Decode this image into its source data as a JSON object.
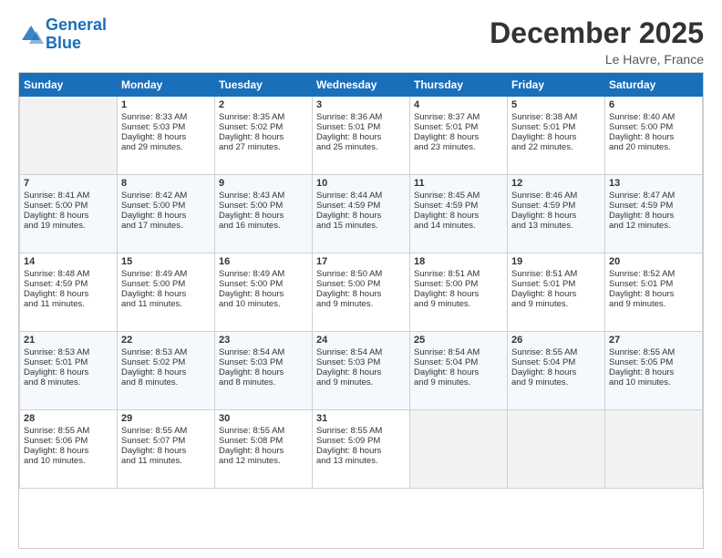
{
  "header": {
    "logo_line1": "General",
    "logo_line2": "Blue",
    "month": "December 2025",
    "location": "Le Havre, France"
  },
  "weekdays": [
    "Sunday",
    "Monday",
    "Tuesday",
    "Wednesday",
    "Thursday",
    "Friday",
    "Saturday"
  ],
  "weeks": [
    [
      {
        "day": "",
        "info": ""
      },
      {
        "day": "1",
        "info": "Sunrise: 8:33 AM\nSunset: 5:03 PM\nDaylight: 8 hours\nand 29 minutes."
      },
      {
        "day": "2",
        "info": "Sunrise: 8:35 AM\nSunset: 5:02 PM\nDaylight: 8 hours\nand 27 minutes."
      },
      {
        "day": "3",
        "info": "Sunrise: 8:36 AM\nSunset: 5:01 PM\nDaylight: 8 hours\nand 25 minutes."
      },
      {
        "day": "4",
        "info": "Sunrise: 8:37 AM\nSunset: 5:01 PM\nDaylight: 8 hours\nand 23 minutes."
      },
      {
        "day": "5",
        "info": "Sunrise: 8:38 AM\nSunset: 5:01 PM\nDaylight: 8 hours\nand 22 minutes."
      },
      {
        "day": "6",
        "info": "Sunrise: 8:40 AM\nSunset: 5:00 PM\nDaylight: 8 hours\nand 20 minutes."
      }
    ],
    [
      {
        "day": "7",
        "info": "Sunrise: 8:41 AM\nSunset: 5:00 PM\nDaylight: 8 hours\nand 19 minutes."
      },
      {
        "day": "8",
        "info": "Sunrise: 8:42 AM\nSunset: 5:00 PM\nDaylight: 8 hours\nand 17 minutes."
      },
      {
        "day": "9",
        "info": "Sunrise: 8:43 AM\nSunset: 5:00 PM\nDaylight: 8 hours\nand 16 minutes."
      },
      {
        "day": "10",
        "info": "Sunrise: 8:44 AM\nSunset: 4:59 PM\nDaylight: 8 hours\nand 15 minutes."
      },
      {
        "day": "11",
        "info": "Sunrise: 8:45 AM\nSunset: 4:59 PM\nDaylight: 8 hours\nand 14 minutes."
      },
      {
        "day": "12",
        "info": "Sunrise: 8:46 AM\nSunset: 4:59 PM\nDaylight: 8 hours\nand 13 minutes."
      },
      {
        "day": "13",
        "info": "Sunrise: 8:47 AM\nSunset: 4:59 PM\nDaylight: 8 hours\nand 12 minutes."
      }
    ],
    [
      {
        "day": "14",
        "info": "Sunrise: 8:48 AM\nSunset: 4:59 PM\nDaylight: 8 hours\nand 11 minutes."
      },
      {
        "day": "15",
        "info": "Sunrise: 8:49 AM\nSunset: 5:00 PM\nDaylight: 8 hours\nand 11 minutes."
      },
      {
        "day": "16",
        "info": "Sunrise: 8:49 AM\nSunset: 5:00 PM\nDaylight: 8 hours\nand 10 minutes."
      },
      {
        "day": "17",
        "info": "Sunrise: 8:50 AM\nSunset: 5:00 PM\nDaylight: 8 hours\nand 9 minutes."
      },
      {
        "day": "18",
        "info": "Sunrise: 8:51 AM\nSunset: 5:00 PM\nDaylight: 8 hours\nand 9 minutes."
      },
      {
        "day": "19",
        "info": "Sunrise: 8:51 AM\nSunset: 5:01 PM\nDaylight: 8 hours\nand 9 minutes."
      },
      {
        "day": "20",
        "info": "Sunrise: 8:52 AM\nSunset: 5:01 PM\nDaylight: 8 hours\nand 9 minutes."
      }
    ],
    [
      {
        "day": "21",
        "info": "Sunrise: 8:53 AM\nSunset: 5:01 PM\nDaylight: 8 hours\nand 8 minutes."
      },
      {
        "day": "22",
        "info": "Sunrise: 8:53 AM\nSunset: 5:02 PM\nDaylight: 8 hours\nand 8 minutes."
      },
      {
        "day": "23",
        "info": "Sunrise: 8:54 AM\nSunset: 5:03 PM\nDaylight: 8 hours\nand 8 minutes."
      },
      {
        "day": "24",
        "info": "Sunrise: 8:54 AM\nSunset: 5:03 PM\nDaylight: 8 hours\nand 9 minutes."
      },
      {
        "day": "25",
        "info": "Sunrise: 8:54 AM\nSunset: 5:04 PM\nDaylight: 8 hours\nand 9 minutes."
      },
      {
        "day": "26",
        "info": "Sunrise: 8:55 AM\nSunset: 5:04 PM\nDaylight: 8 hours\nand 9 minutes."
      },
      {
        "day": "27",
        "info": "Sunrise: 8:55 AM\nSunset: 5:05 PM\nDaylight: 8 hours\nand 10 minutes."
      }
    ],
    [
      {
        "day": "28",
        "info": "Sunrise: 8:55 AM\nSunset: 5:06 PM\nDaylight: 8 hours\nand 10 minutes."
      },
      {
        "day": "29",
        "info": "Sunrise: 8:55 AM\nSunset: 5:07 PM\nDaylight: 8 hours\nand 11 minutes."
      },
      {
        "day": "30",
        "info": "Sunrise: 8:55 AM\nSunset: 5:08 PM\nDaylight: 8 hours\nand 12 minutes."
      },
      {
        "day": "31",
        "info": "Sunrise: 8:55 AM\nSunset: 5:09 PM\nDaylight: 8 hours\nand 13 minutes."
      },
      {
        "day": "",
        "info": ""
      },
      {
        "day": "",
        "info": ""
      },
      {
        "day": "",
        "info": ""
      }
    ]
  ]
}
